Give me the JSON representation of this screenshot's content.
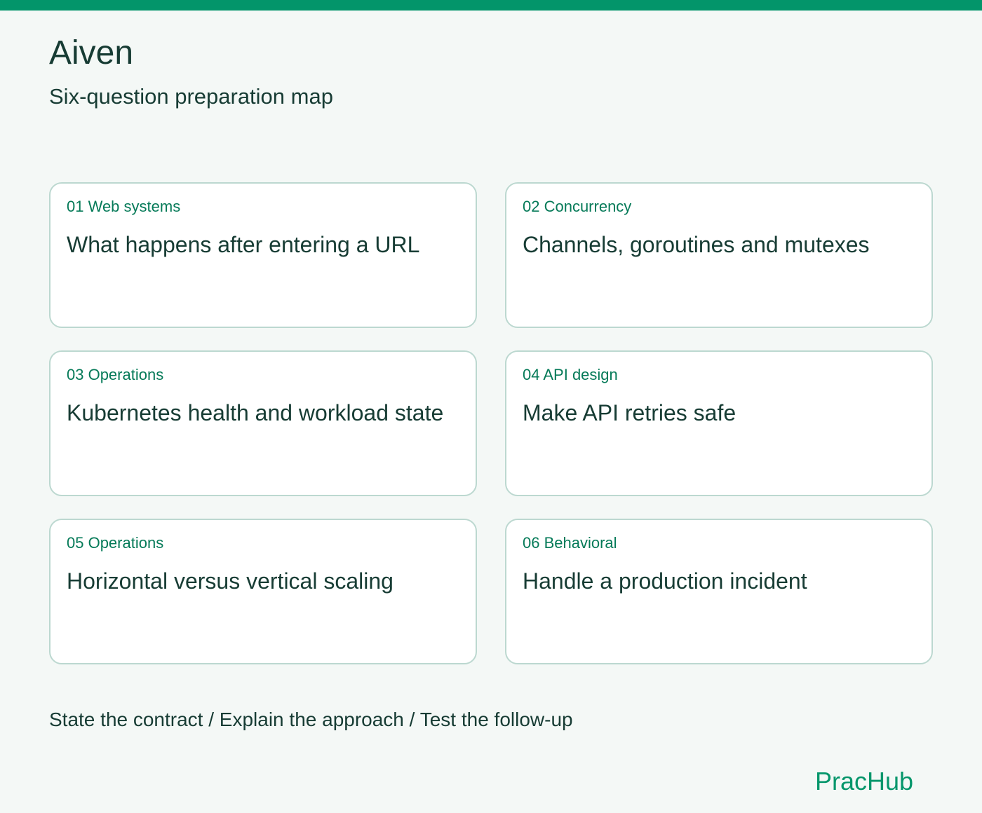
{
  "header": {
    "title": "Aiven",
    "subtitle": "Six-question preparation map"
  },
  "cards": [
    {
      "tag": "01 Web systems",
      "title": "What happens after entering a URL"
    },
    {
      "tag": "02 Concurrency",
      "title": "Channels, goroutines and mutexes"
    },
    {
      "tag": "03 Operations",
      "title": "Kubernetes health and workload state"
    },
    {
      "tag": "04 API design",
      "title": "Make API retries safe"
    },
    {
      "tag": "05 Operations",
      "title": "Horizontal versus vertical scaling"
    },
    {
      "tag": "06 Behavioral",
      "title": "Handle a production incident"
    }
  ],
  "footer": {
    "steps": "State the contract / Explain the approach / Test the follow-up",
    "brand": "PracHub"
  },
  "colors": {
    "accent": "#03956a",
    "background": "#f4f8f6",
    "text": "#173c34",
    "card_border": "#bcd8d0"
  }
}
